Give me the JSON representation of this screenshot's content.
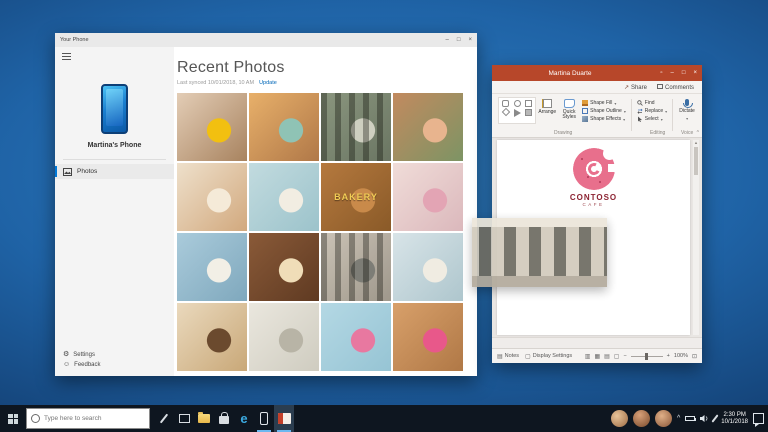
{
  "your_phone": {
    "window_title": "Your Phone",
    "device_name": "Martina's Phone",
    "nav_photos": "Photos",
    "nav_settings": "Settings",
    "nav_feedback": "Feedback",
    "heading": "Recent Photos",
    "sync_status": "Last synced 10/01/2018, 10 AM",
    "update_link": "Update",
    "photos": [
      {
        "name": "dog-with-ball",
        "c1": "#e3cdb6",
        "c2": "#a8835f",
        "accent": "#f2c010"
      },
      {
        "name": "flower-field",
        "c1": "#e8b06a",
        "c2": "#b07848",
        "accent": "#8fc3b5"
      },
      {
        "name": "feet-on-log",
        "c1": "#7d8a70",
        "c2": "#5a6651",
        "accent": "#c9cab9",
        "stripes": true
      },
      {
        "name": "family-selfie",
        "c1": "#c28a5f",
        "c2": "#7d9464",
        "accent": "#e8b48e"
      },
      {
        "name": "beach-kids",
        "c1": "#eee0cb",
        "c2": "#d2a97e",
        "accent": "#f5ead8"
      },
      {
        "name": "baking-flatlay",
        "c1": "#c2dbdf",
        "c2": "#9cc3cb",
        "accent": "#f2ede2"
      },
      {
        "name": "bakery-sign",
        "c1": "#b5793e",
        "c2": "#8a5a28",
        "accent": "#c98a4a",
        "label": "BAKERY"
      },
      {
        "name": "pink-donuts",
        "c1": "#f0dcd8",
        "c2": "#dbb8bc",
        "accent": "#e3a4b4"
      },
      {
        "name": "cheesecake",
        "c1": "#aacbdb",
        "c2": "#7fa8bd",
        "accent": "#f2efe6"
      },
      {
        "name": "cupcakes",
        "c1": "#8a5a38",
        "c2": "#5f3a22",
        "accent": "#f0ddb8"
      },
      {
        "name": "cafe-storefront",
        "c1": "#c5bcae",
        "c2": "#948c7e",
        "accent": "#6e6e66",
        "stripes": true
      },
      {
        "name": "bakery-interior",
        "c1": "#d8e4e8",
        "c2": "#aec6cd",
        "accent": "#f0ece2"
      },
      {
        "name": "baking-eggs",
        "c1": "#ead9bd",
        "c2": "#c9a878",
        "accent": "#6b4a2e"
      },
      {
        "name": "kitchen-tools",
        "c1": "#eae7de",
        "c2": "#cfccc0",
        "accent": "#b8b4a6"
      },
      {
        "name": "two-donuts",
        "c1": "#b4d8e4",
        "c2": "#96c4d4",
        "accent": "#e878a0"
      },
      {
        "name": "many-donuts",
        "c1": "#d8a06a",
        "c2": "#b07846",
        "accent": "#e8588a"
      }
    ]
  },
  "powerpoint": {
    "window_title": "Martina Duarte",
    "share_label": "Share",
    "comments_label": "Comments",
    "ribbon": {
      "arrange": "Arrange",
      "quick_styles": "Quick Styles",
      "shape_fill": "Shape Fill",
      "shape_outline": "Shape Outline",
      "shape_effects": "Shape Effects",
      "find": "Find",
      "replace": "Replace",
      "select": "Select",
      "dictate": "Dictate",
      "group_drawing": "Drawing",
      "group_editing": "Editing",
      "group_voice": "Voice"
    },
    "slide": {
      "brand": "CONTOSO",
      "brand_sub": "CAFE"
    },
    "status": {
      "notes": "Notes",
      "display_settings": "Display Settings",
      "zoom_level": "100%"
    }
  },
  "taskbar": {
    "search_placeholder": "Type here to search",
    "time": "2:30 PM",
    "date": "10/1/2018"
  },
  "icons": {
    "minimize": "–",
    "maximize": "□",
    "close": "×",
    "ribbon_options": "▫",
    "settings": "⚙",
    "feedback": "☺",
    "share_arrow": "↗",
    "dropdown": "▾",
    "collapse_ribbon": "^",
    "scroll_up": "▲",
    "scroll_down": "▼",
    "notes": "▤",
    "display": "▢",
    "view_normal": "▥",
    "view_sorter": "▦",
    "view_reading": "▤",
    "view_slideshow": "▢",
    "zoom_minus": "−",
    "zoom_plus": "+",
    "fit": "⊡",
    "edge": "e",
    "chevron_up": "^"
  },
  "colors": {
    "accent_blue": "#0078d7",
    "ppt_red": "#b7472a",
    "donut_pink": "#e86f8c",
    "brand_maroon": "#8c2332"
  }
}
